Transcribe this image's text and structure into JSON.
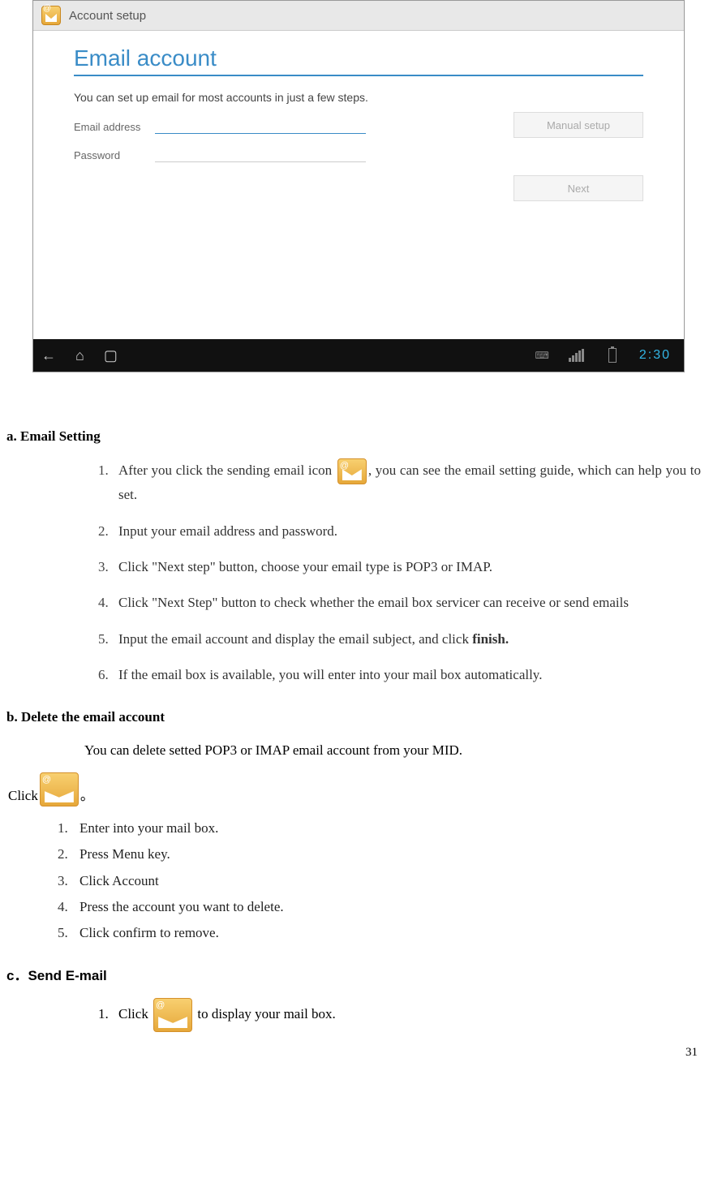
{
  "screenshot": {
    "header_title": "Account setup",
    "title": "Email account",
    "desc": "You can set up email for most accounts in just a few steps.",
    "label_email": "Email address",
    "label_password": "Password",
    "btn_manual": "Manual setup",
    "btn_next": "Next",
    "clock": "2:30",
    "kbd_glyph": "⌨"
  },
  "section_a_title": "a. Email Setting",
  "a_steps": {
    "s1_pre": "After you click the sending email icon ",
    "s1_post": ", you can see the email setting guide, which can help you to set.",
    "s2": "Input your email address and password.",
    "s3": "Click \"Next step\" button, choose your email type is POP3 or IMAP.",
    "s4": "Click \"Next Step\" button to check whether the email box servicer can receive or send emails",
    "s5_pre": "Input the email account and display the email subject, and click ",
    "s5_bold": "finish.",
    "s6": "If the email box is available, you will enter into your mail box automatically."
  },
  "section_b_title": "b. Delete the email account",
  "b_intro": "You can delete setted POP3 or IMAP email account from your MID.",
  "b_click": "Click",
  "b_click_end": "。",
  "b_steps": {
    "s1": "Enter into your mail box.",
    "s2": "Press Menu key.",
    "s3": "Click Account",
    "s4": "Press the account you want to delete.",
    "s5": "Click confirm to remove."
  },
  "section_c_title": "c．Send E-mail",
  "c_steps": {
    "s1_pre": "Click ",
    "s1_post": " to display your mail box."
  },
  "page_number": "31"
}
